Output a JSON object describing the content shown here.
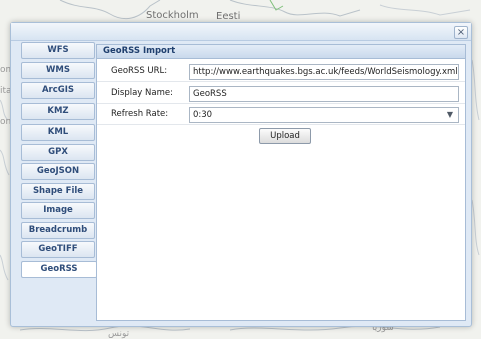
{
  "map": {
    "labels": {
      "stockholm": "Stockholm",
      "eesti": "Eesti",
      "left_fragment_1": "om",
      "left_fragment_2": "italı",
      "left_fragment_3": "on",
      "bottom_tunis": "تونس",
      "bottom_syria": "سوريا"
    }
  },
  "dialog": {
    "close_label": "×",
    "sidebar": {
      "items": [
        {
          "label": "WFS",
          "active": false
        },
        {
          "label": "WMS",
          "active": false
        },
        {
          "label": "ArcGIS",
          "active": false
        },
        {
          "label": "KMZ",
          "active": false
        },
        {
          "label": "KML",
          "active": false
        },
        {
          "label": "GPX",
          "active": false
        },
        {
          "label": "GeoJSON",
          "active": false
        },
        {
          "label": "Shape File",
          "active": false
        },
        {
          "label": "Image",
          "active": false
        },
        {
          "label": "Breadcrumb",
          "active": false
        },
        {
          "label": "GeoTIFF",
          "active": false
        },
        {
          "label": "GeoRSS",
          "active": true
        }
      ]
    },
    "panel": {
      "title": "GeoRSS Import",
      "fields": {
        "url": {
          "label": "GeoRSS URL:",
          "value": "http://www.earthquakes.bgs.ac.uk/feeds/WorldSeismology.xml"
        },
        "display_name": {
          "label": "Display Name:",
          "value": "GeoRSS"
        },
        "refresh_rate": {
          "label": "Refresh Rate:",
          "value": "0:30"
        }
      },
      "upload_label": "Upload"
    }
  },
  "colors": {
    "accent": "#2f4d7a",
    "panel_header_bg": "#c9d9ec",
    "dialog_bg": "#dfe9f5",
    "map_bg": "#f1f2ee"
  },
  "icons": {
    "close": "close-icon",
    "select_arrow": "chevron-down-icon"
  }
}
